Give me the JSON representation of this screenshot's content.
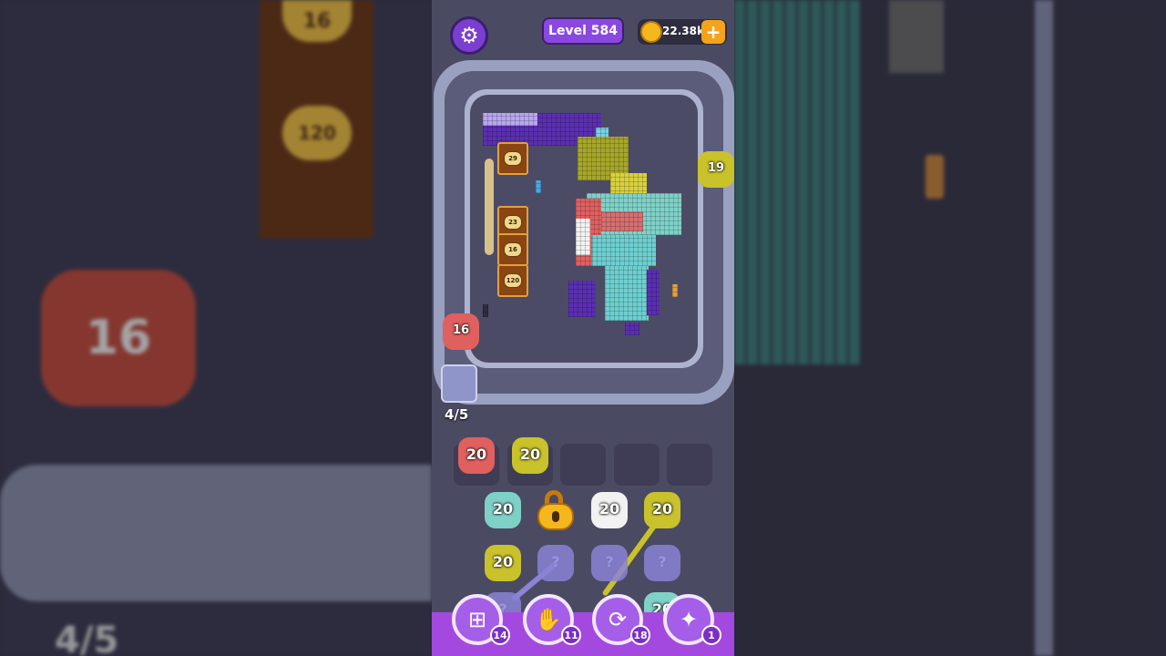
{
  "hud": {
    "level_label": "Level 584",
    "coins_label": "22.38k",
    "plus_symbol": "+",
    "settings_icon": "gear-icon"
  },
  "board": {
    "progress_label": "4/5",
    "crates": [
      "29",
      "23",
      "16",
      "120"
    ],
    "conveyor_shooters": [
      {
        "count": "19",
        "color": "#c9c22a"
      },
      {
        "count": "16",
        "color": "#e06060"
      }
    ]
  },
  "queue_slots": [
    {
      "count": "20",
      "color": "#e06060"
    },
    {
      "count": "20",
      "color": "#c9c22a"
    },
    {
      "count": "",
      "color": ""
    },
    {
      "count": "",
      "color": ""
    },
    {
      "count": "",
      "color": ""
    }
  ],
  "grid": {
    "row1": [
      {
        "count": "20",
        "color": "#7fd1c8"
      },
      {
        "count": "",
        "color": "#f5b81c",
        "locked": true
      },
      {
        "count": "20",
        "color": "#f2f2f2"
      },
      {
        "count": "20",
        "color": "#c9c22a"
      }
    ],
    "row2": [
      {
        "count": "20",
        "color": "#c9c22a"
      },
      {
        "count": "?",
        "color": "#8a83d6"
      },
      {
        "count": "?",
        "color": "#8a83d6"
      },
      {
        "count": "?",
        "color": "#8a83d6"
      }
    ],
    "row3": [
      {
        "count": "?",
        "color": "#8a83d6"
      },
      {
        "count": "20",
        "color": "#7fd1c8"
      }
    ]
  },
  "tools": [
    {
      "icon": "add-slot-icon",
      "count": "14"
    },
    {
      "icon": "hand-icon",
      "count": "11"
    },
    {
      "icon": "shuffle-icon",
      "count": "18"
    },
    {
      "icon": "magic-icon",
      "count": "1"
    }
  ],
  "background": {
    "left_crates": [
      "16",
      "120"
    ],
    "left_shooter_count": "16",
    "left_progress_label": "4/5"
  }
}
